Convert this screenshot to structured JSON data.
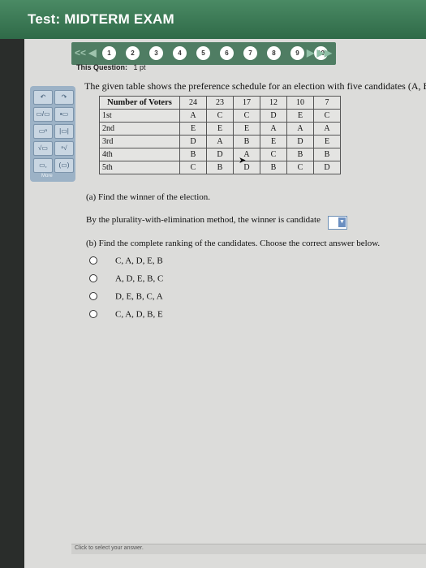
{
  "header": {
    "title": "Test:  MIDTERM EXAM"
  },
  "nav": {
    "prev_label": "<< ◀",
    "questions": [
      "1",
      "2",
      "3",
      "4",
      "5",
      "6",
      "7",
      "8",
      "9",
      "10"
    ],
    "next_label": "▶ ▶▶"
  },
  "question_meta": {
    "label": "This Question:",
    "points": "1 pt"
  },
  "toolbox": {
    "more_label": "More"
  },
  "intro": "The given table shows the preference schedule for an election with five candidates (A, B, C",
  "table": {
    "header_label": "Number of Voters",
    "voters": [
      "24",
      "23",
      "17",
      "12",
      "10",
      "7"
    ],
    "rows": [
      {
        "label": "1st",
        "cells": [
          "A",
          "C",
          "C",
          "D",
          "E",
          "C"
        ]
      },
      {
        "label": "2nd",
        "cells": [
          "E",
          "E",
          "E",
          "A",
          "A",
          "A"
        ]
      },
      {
        "label": "3rd",
        "cells": [
          "D",
          "A",
          "B",
          "E",
          "D",
          "E"
        ]
      },
      {
        "label": "4th",
        "cells": [
          "B",
          "D",
          "A",
          "C",
          "B",
          "B"
        ]
      },
      {
        "label": "5th",
        "cells": [
          "C",
          "B",
          "D",
          "B",
          "C",
          "D"
        ]
      }
    ]
  },
  "part_a": {
    "heading": "(a) Find the winner of the election.",
    "prompt": "By the plurality-with-elimination method, the winner is candidate"
  },
  "part_b": {
    "heading": "(b) Find the complete ranking of the candidates. Choose the correct answer below."
  },
  "options": [
    "C, A, D, E, B",
    "A, D, E, B, C",
    "D, E, B, C, A",
    "C, A, D, B, E"
  ],
  "footer": {
    "text": "Click to select your answer."
  },
  "colors": {
    "header_green": "#3d7a55",
    "nav_green": "#4f7d63",
    "tool_blue": "#9cb2c6"
  }
}
